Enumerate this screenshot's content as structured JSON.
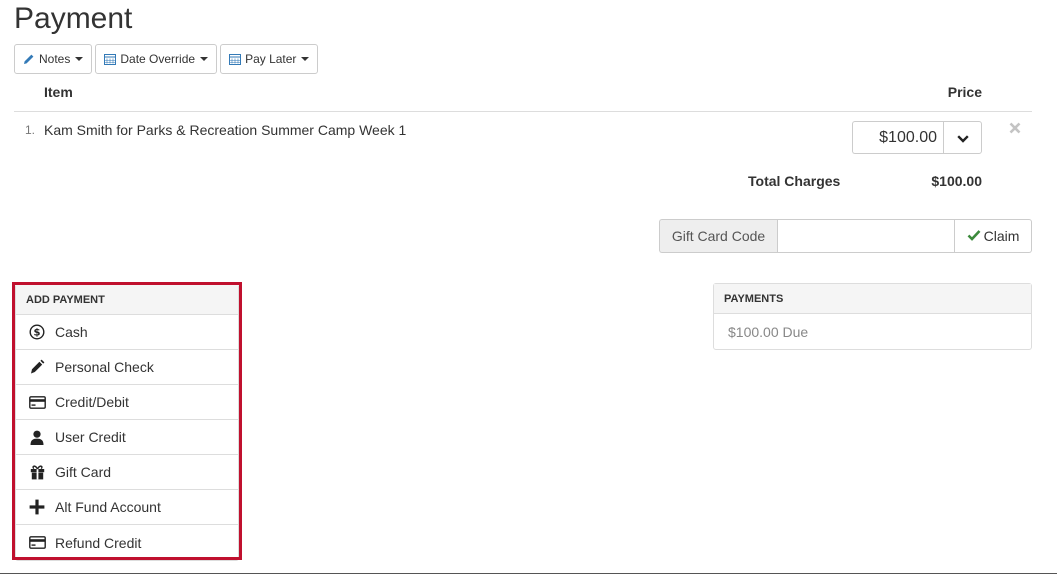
{
  "page": {
    "title": "Payment"
  },
  "toolbar": {
    "notes_label": "Notes",
    "date_override_label": "Date Override",
    "pay_later_label": "Pay Later"
  },
  "table": {
    "col_item": "Item",
    "col_price": "Price",
    "rows": [
      {
        "num": "1.",
        "description": "Kam Smith for Parks & Recreation Summer Camp Week 1",
        "price": "$100.00"
      }
    ]
  },
  "totals": {
    "label": "Total Charges",
    "value": "$100.00"
  },
  "gift_card": {
    "label": "Gift Card Code",
    "value": "",
    "placeholder": "",
    "claim_label": "Claim"
  },
  "add_payment": {
    "title": "ADD PAYMENT",
    "items": [
      {
        "label": "Cash",
        "icon": "cash-icon"
      },
      {
        "label": "Personal Check",
        "icon": "pen-icon"
      },
      {
        "label": "Credit/Debit",
        "icon": "credit-card-icon"
      },
      {
        "label": "User Credit",
        "icon": "user-icon"
      },
      {
        "label": "Gift Card",
        "icon": "gift-icon"
      },
      {
        "label": "Alt Fund Account",
        "icon": "plus-icon"
      },
      {
        "label": "Refund Credit",
        "icon": "credit-card-icon"
      }
    ]
  },
  "payments": {
    "title": "PAYMENTS",
    "due_text": "$100.00 Due"
  },
  "colors": {
    "highlight": "#c0102e",
    "check": "#3c8a3c",
    "accent_icon": "#337ab7"
  }
}
